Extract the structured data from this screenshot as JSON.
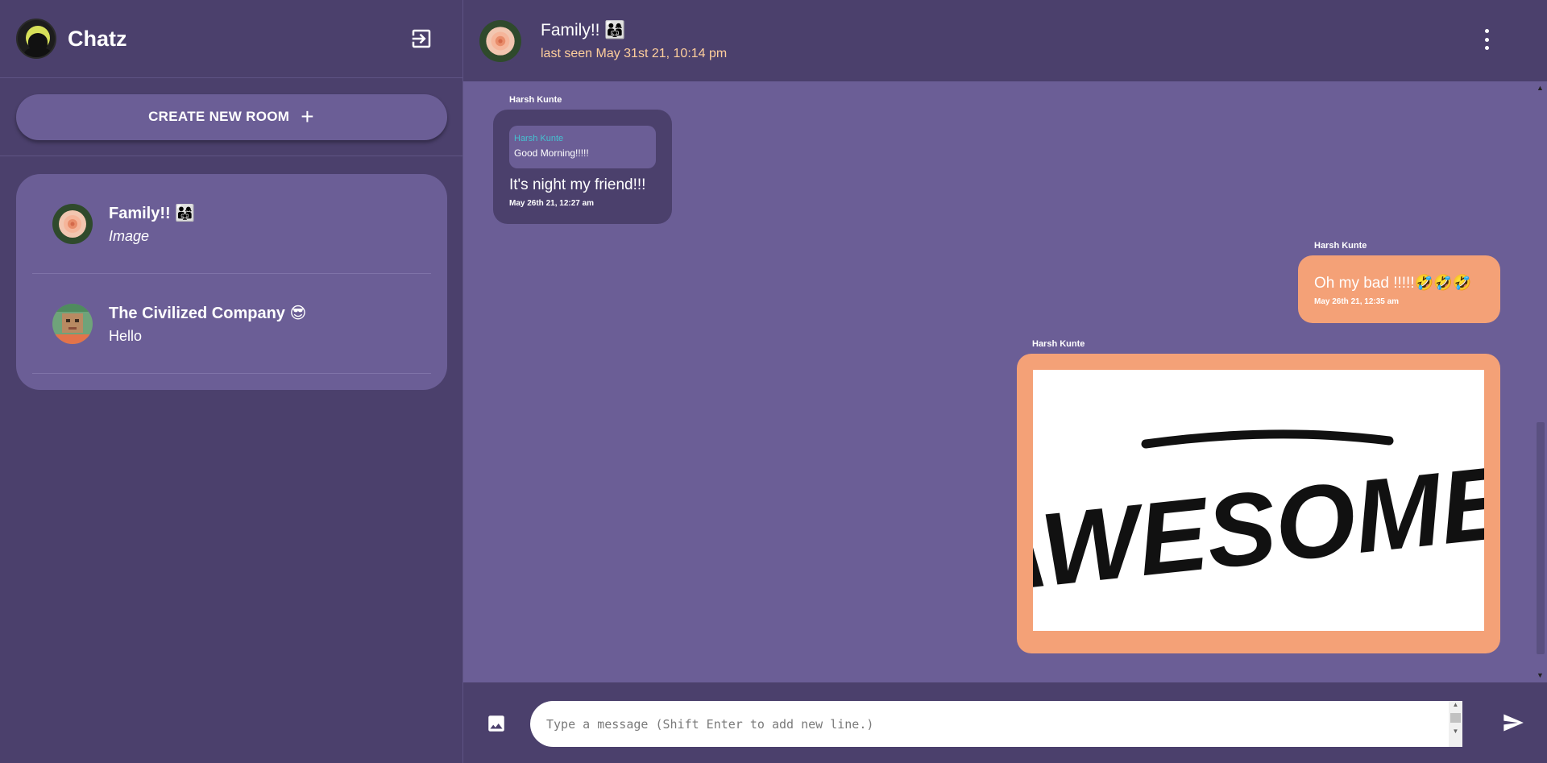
{
  "app": {
    "title": "Chatz"
  },
  "sidebar": {
    "create_room_label": "CREATE NEW ROOM",
    "create_room_icon": "+",
    "rooms": [
      {
        "name": "Family!! 👨‍👩‍👧",
        "last_message": "Image",
        "avatar": "rose-avatar"
      },
      {
        "name": "The Civilized Company 😎",
        "last_message": "Hello",
        "avatar": "pixel-face-avatar"
      }
    ]
  },
  "chat": {
    "title": "Family!! 👨‍👩‍👧",
    "subtitle": "last seen May 31st 21, 10:14 pm",
    "messages": [
      {
        "author": "Harsh Kunte",
        "direction": "incoming",
        "quote": {
          "author": "Harsh Kunte",
          "text": "Good Morning!!!!!"
        },
        "text": "It's night my friend!!!",
        "time": "May 26th 21, 12:27 am"
      },
      {
        "author": "Harsh Kunte",
        "direction": "outgoing",
        "text": "Oh my bad !!!!!🤣🤣🤣",
        "time": "May 26th 21, 12:35 am"
      },
      {
        "author": "Harsh Kunte",
        "direction": "outgoing",
        "image_text": "AWESOME!"
      }
    ]
  },
  "composer": {
    "placeholder": "Type a message (Shift Enter to add new line.)"
  },
  "colors": {
    "sidebar_bg": "#4b406c",
    "chat_bg": "#6b5e96",
    "outgoing_bubble": "#f4a177",
    "incoming_bubble": "#4b406c",
    "subtitle_accent": "#ffcf9c",
    "quote_name": "#45c1d0"
  }
}
